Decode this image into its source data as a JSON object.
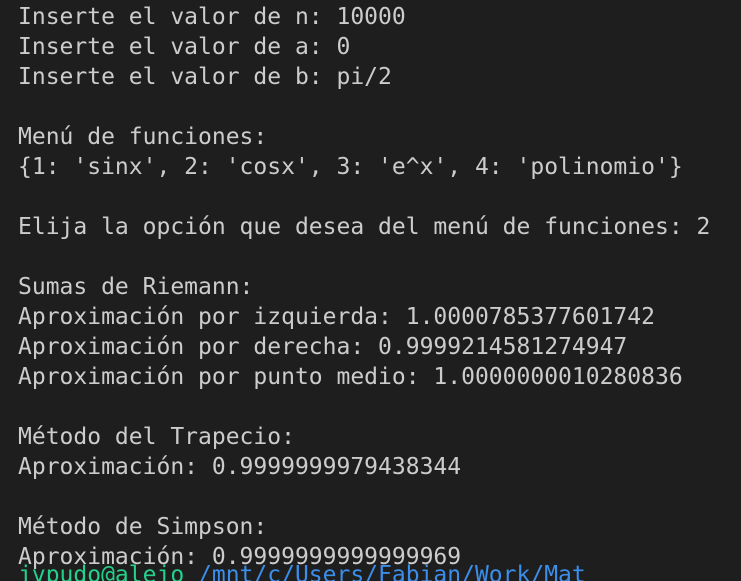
{
  "terminal": {
    "colors": {
      "background": "#1e1e1e",
      "text": "#cccccc",
      "prompt_user": "#23d18b",
      "prompt_path": "#3b8eea"
    },
    "lines": {
      "n_prompt": "Inserte el valor de n: 10000",
      "a_prompt": "Inserte el valor de a: 0",
      "b_prompt": "Inserte el valor de b: pi/2",
      "menu_title": "Menú de funciones:",
      "menu_dict": "{1: 'sinx', 2: 'cosx', 3: 'e^x', 4: 'polinomio'}",
      "choice": "Elija la opción que desea del menú de funciones: 2",
      "riemann_title": "Sumas de Riemann:",
      "riemann_left": "Aproximación por izquierda: 1.0000785377601742",
      "riemann_right": "Aproximación por derecha: 0.9999214581274947",
      "riemann_mid": "Aproximación por punto medio: 1.0000000010280836",
      "trap_title": "Método del Trapecio:",
      "trap_value": "Aproximación: 0.9999999979438344",
      "simpson_title": "Método de Simpson:",
      "simpson_value": "Aproximación: 0.9999999999999969"
    },
    "next_prompt": {
      "user": "jvpudo@alejo",
      "path": " /mnt/c/Users/Fabian/Work/Mat"
    }
  }
}
